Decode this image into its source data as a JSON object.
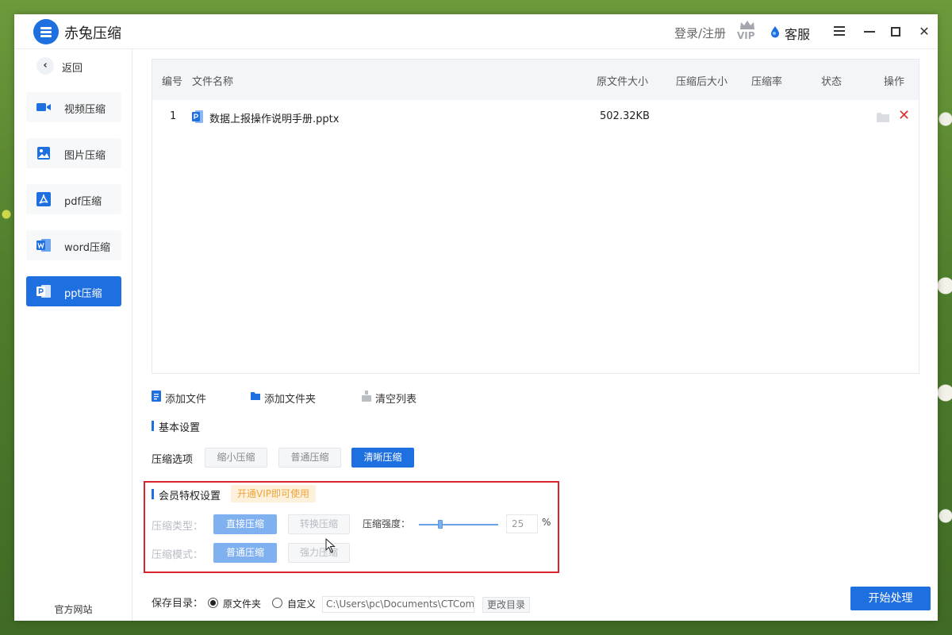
{
  "app": {
    "title": "赤兔压缩",
    "login_register": "登录/注册",
    "vip_badge": "VIP",
    "service": "客服",
    "accent_color": "#1e6fe0"
  },
  "sidebar": {
    "back": "返回",
    "items": [
      {
        "label": "视频压缩",
        "icon": "video-icon"
      },
      {
        "label": "图片压缩",
        "icon": "image-icon"
      },
      {
        "label": "pdf压缩",
        "icon": "pdf-icon"
      },
      {
        "label": "word压缩",
        "icon": "word-icon"
      },
      {
        "label": "ppt压缩",
        "icon": "ppt-icon",
        "active": true
      }
    ],
    "official_site": "官方网站"
  },
  "file_table": {
    "columns": [
      "编号",
      "文件名称",
      "原文件大小",
      "压缩后大小",
      "压缩率",
      "状态",
      "操作"
    ],
    "rows": [
      {
        "index": "1",
        "name": "数据上报操作说明手册.pptx",
        "original_size": "502.32KB",
        "compressed_size": "",
        "ratio": "",
        "status": ""
      }
    ]
  },
  "actions": {
    "add_file": "添加文件",
    "add_folder": "添加文件夹",
    "clear_list": "清空列表"
  },
  "basic_settings": {
    "title": "基本设置",
    "option_label": "压缩选项",
    "options": [
      "缩小压缩",
      "普通压缩",
      "清晰压缩"
    ],
    "selected": "清晰压缩"
  },
  "vip_settings": {
    "title": "会员特权设置",
    "tag": "开通VIP即可使用",
    "type_label": "压缩类型：",
    "type_options": [
      "直接压缩",
      "转换压缩"
    ],
    "type_selected": "直接压缩",
    "strength_label": "压缩强度：",
    "strength_value": "25",
    "strength_unit": "%",
    "mode_label": "压缩模式：",
    "mode_options": [
      "普通压缩",
      "强力压缩"
    ],
    "mode_selected": "普通压缩"
  },
  "save": {
    "label": "保存目录：",
    "options": [
      "原文件夹",
      "自定义"
    ],
    "selected": "原文件夹",
    "path": "C:\\Users\\pc\\Documents\\CTCom",
    "change_button": "更改目录"
  },
  "start_button": "开始处理"
}
